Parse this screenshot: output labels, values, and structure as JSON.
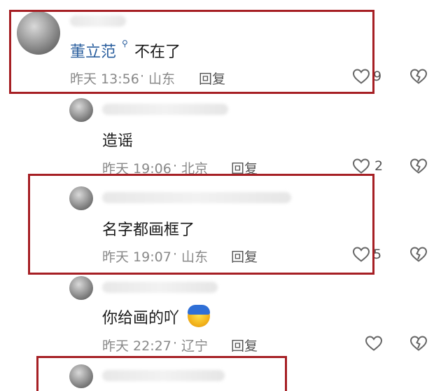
{
  "comments": [
    {
      "name": "董立范",
      "text": "不在了",
      "time": "昨天 13:56",
      "location": "山东",
      "reply_label": "回复",
      "likes": "9"
    },
    {
      "text": "造谣",
      "time": "昨天 19:06",
      "location": "北京",
      "reply_label": "回复",
      "likes": "2"
    },
    {
      "text": "名字都画框了",
      "time": "昨天 19:07",
      "location": "山东",
      "reply_label": "回复",
      "likes": "5"
    },
    {
      "text": "你给画的吖",
      "time": "昨天 22:27",
      "location": "辽宁",
      "reply_label": "回复",
      "likes": ""
    }
  ],
  "separator": "·",
  "colors": {
    "highlight_box": "#a61f24",
    "username": "#2b5f9e",
    "meta": "#888888"
  },
  "icons": [
    "search-icon",
    "heart-icon",
    "broken-heart-icon",
    "emoji-icon"
  ]
}
